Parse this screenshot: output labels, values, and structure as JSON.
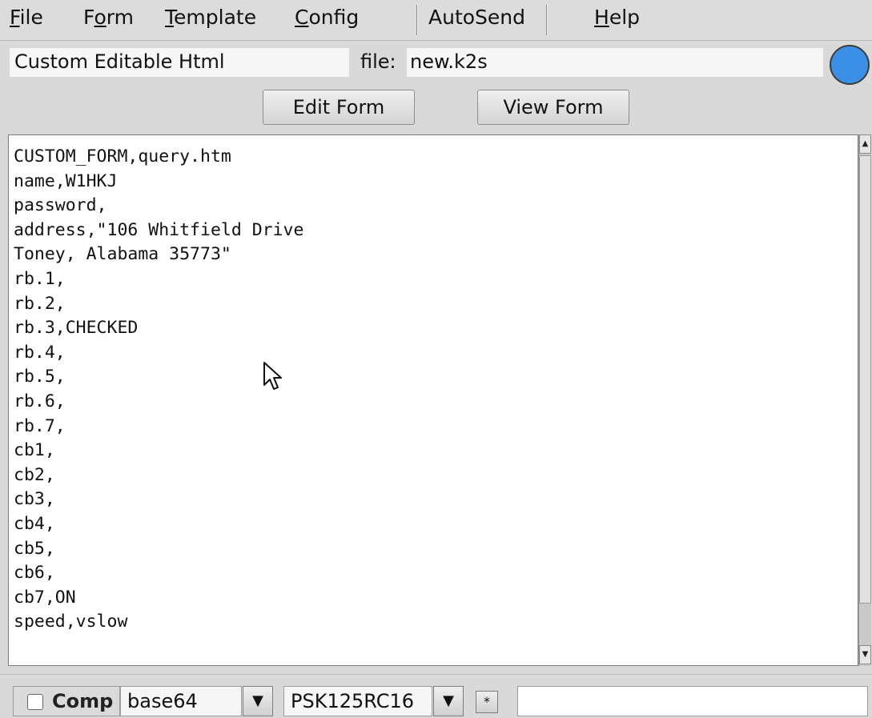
{
  "menu": {
    "file": {
      "u": "F",
      "rest": "ile"
    },
    "form": {
      "pre": "F",
      "u": "o",
      "rest": "rm"
    },
    "template": {
      "u": "T",
      "rest": "emplate"
    },
    "config": {
      "u": "C",
      "rest": "onfig"
    },
    "autosend": "AutoSend",
    "help": {
      "u": "H",
      "rest": "elp"
    }
  },
  "info": {
    "form_name": "Custom Editable Html",
    "file_label": "file:",
    "file_name": "new.k2s",
    "status_light_color": "#3b8fe4"
  },
  "buttons": {
    "edit_form": "Edit Form",
    "view_form": "View Form"
  },
  "editor": {
    "lines": [
      "CUSTOM_FORM,query.htm",
      "name,W1HKJ",
      "password,",
      "address,\"106 Whitfield Drive",
      "Toney, Alabama 35773\"",
      "rb.1,",
      "rb.2,",
      "rb.3,CHECKED",
      "rb.4,",
      "rb.5,",
      "rb.6,",
      "rb.7,",
      "cb1,",
      "cb2,",
      "cb3,",
      "cb4,",
      "cb5,",
      "cb6,",
      "cb7,ON",
      "speed,vslow"
    ]
  },
  "bottom": {
    "comp_label": "Comp",
    "comp_checked": false,
    "encoding": "base64",
    "mode": "PSK125RC16",
    "star_label": "*",
    "transfer_field": ""
  },
  "icons": {
    "dropdown": "triangle-down",
    "mouse_cursor": "arrow-pointer",
    "scroll_up": "triangle-up",
    "scroll_down": "triangle-down"
  }
}
